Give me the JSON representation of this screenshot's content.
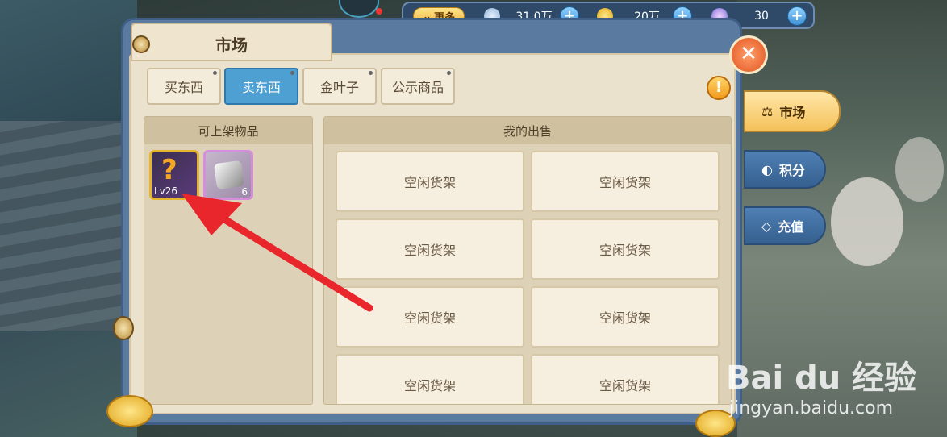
{
  "topbar": {
    "more_label": "更多",
    "currencies": [
      {
        "icon": "feather-crystal-icon",
        "value": "31.0万"
      },
      {
        "icon": "gold-leaf-icon",
        "value": "20万"
      },
      {
        "icon": "gem-icon",
        "value": "30"
      }
    ],
    "plus_symbol": "+"
  },
  "panel": {
    "title": "市场",
    "tabs": [
      "买东西",
      "卖东西",
      "金叶子",
      "公示商品"
    ],
    "active_tab": "卖东西",
    "close_symbol": "✕",
    "warn_symbol": "!"
  },
  "inventory": {
    "header": "可上架物品",
    "items": [
      {
        "name": "mystery-weapon",
        "label": "Lv26",
        "glyph": "?"
      },
      {
        "name": "stone-material",
        "label": "6"
      }
    ]
  },
  "sales": {
    "header": "我的出售",
    "slots": [
      "空闲货架",
      "空闲货架",
      "空闲货架",
      "空闲货架",
      "空闲货架",
      "空闲货架",
      "空闲货架",
      "空闲货架"
    ]
  },
  "side_tabs": [
    {
      "label": "市场",
      "icon": "scale-icon",
      "glyph": "⚖"
    },
    {
      "label": "积分",
      "icon": "points-icon",
      "glyph": "◐"
    },
    {
      "label": "充值",
      "icon": "diamond-icon",
      "glyph": "◇"
    }
  ],
  "watermark": {
    "brand": "Bai du 经验",
    "url": "jingyan.baidu.com"
  },
  "colors": {
    "active_tab": "#4fa0d2",
    "paper": "#ebe2cd",
    "frame": "#5a7aa0",
    "arrow": "#e8262b"
  }
}
